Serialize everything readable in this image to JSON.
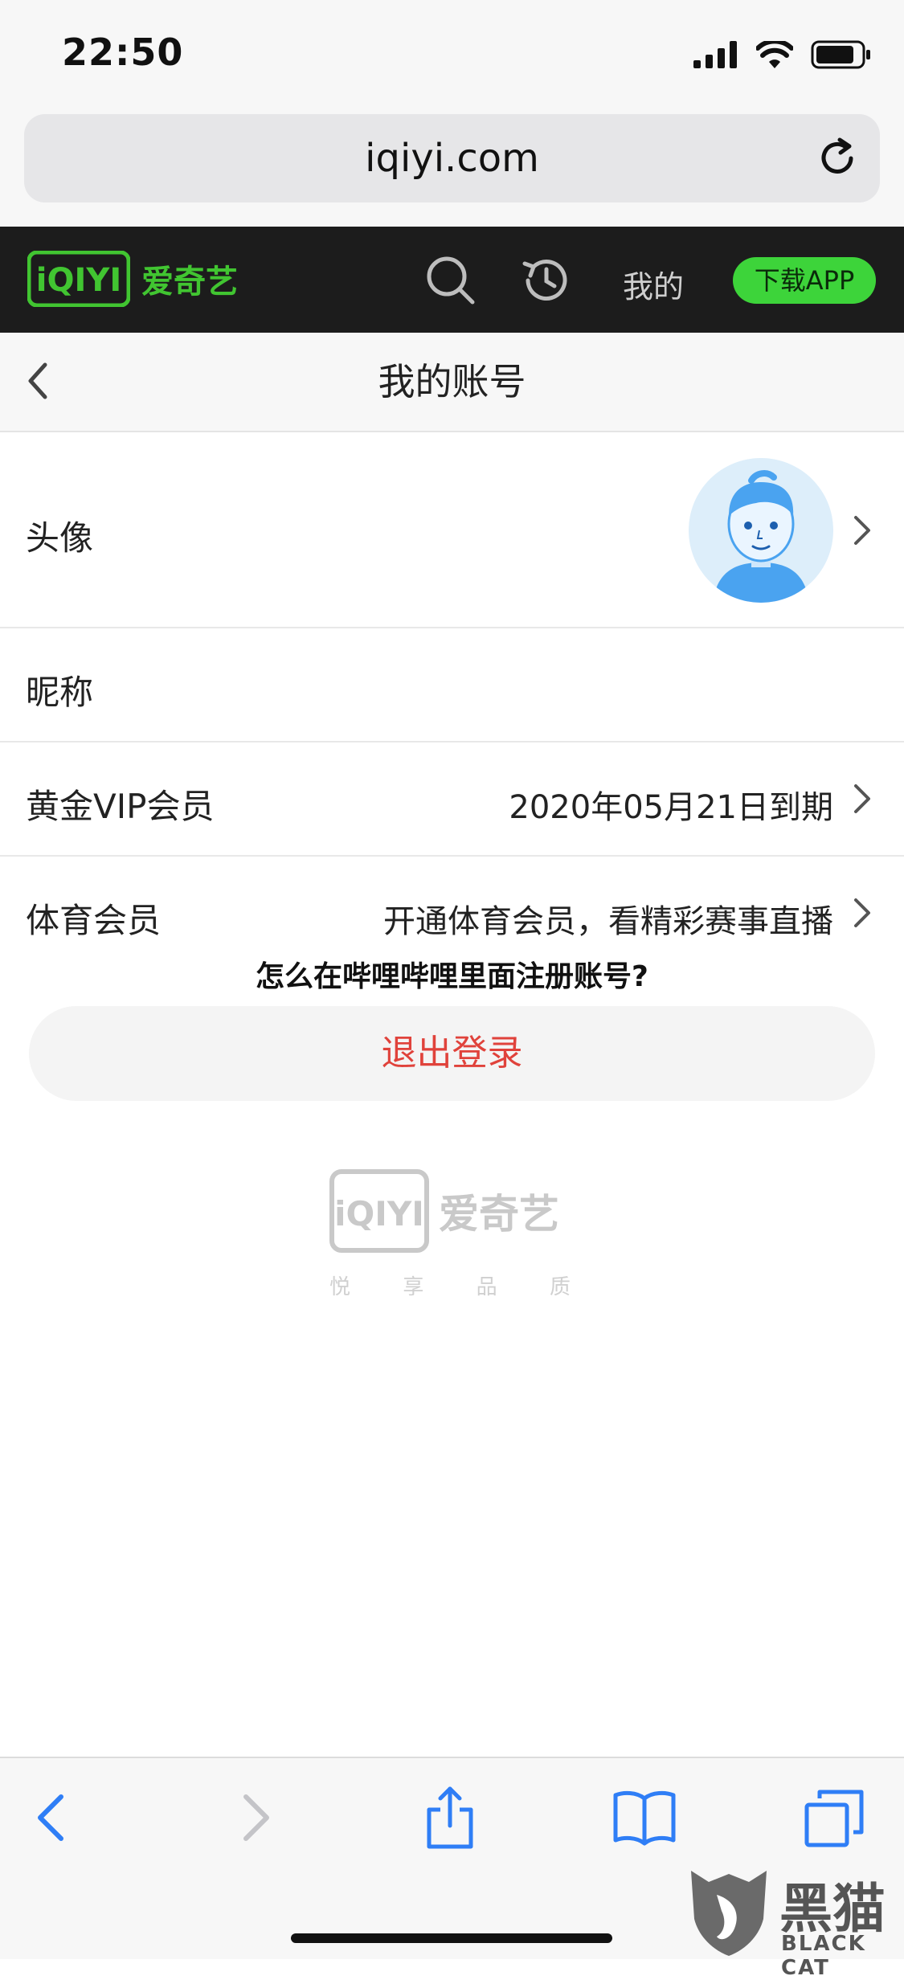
{
  "status_bar": {
    "time": "22:50"
  },
  "browser": {
    "url": "iqiyi.com"
  },
  "site_header": {
    "logo_mark": "iQIYI",
    "logo_text": "爱奇艺",
    "mine_label": "我的",
    "download_label": "下载APP",
    "accent_color": "#3dd43a"
  },
  "page": {
    "title": "我的账号"
  },
  "rows": {
    "avatar": {
      "label": "头像"
    },
    "nickname": {
      "label": "昵称",
      "value": ""
    },
    "vip": {
      "label": "黄金VIP会员",
      "value": "2020年05月21日到期"
    },
    "sports": {
      "label": "体育会员",
      "value": "开通体育会员，看精彩赛事直播"
    }
  },
  "caption": "怎么在哔哩哔哩里面注册账号?",
  "logout_label": "退出登录",
  "footer": {
    "logo_mark": "iQIYI",
    "logo_text": "爱奇艺",
    "slogan": [
      "悦",
      "享",
      "品",
      "质"
    ]
  },
  "toolbar": {
    "icons": [
      "back-icon",
      "forward-icon",
      "share-icon",
      "bookmarks-icon",
      "tabs-icon"
    ]
  },
  "watermark": {
    "text": "黑猫",
    "sub": "BLACK CAT"
  }
}
